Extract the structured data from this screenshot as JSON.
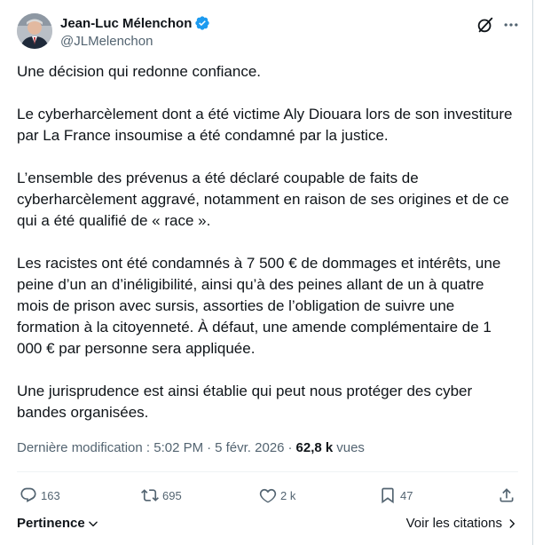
{
  "author": {
    "name": "Jean-Luc Mélenchon",
    "handle": "@JLMelenchon"
  },
  "tweet": {
    "paragraphs": [
      "Une décision qui redonne confiance.",
      "Le cyberharcèlement dont a été victime Aly Diouara lors de son investiture par La France insoumise a été condamné par la justice.",
      "L’ensemble des prévenus a été déclaré coupable de faits de cyberharcèlement aggravé, notamment en raison de ses origines et de ce qui a été qualifié de « race ».",
      "Les racistes ont été condamnés à 7 500 € de dommages et intérêts, une peine d’un an d’inéligibilité, ainsi qu’à des peines allant de un à quatre mois de prison avec sursis, assorties de l’obligation de suivre une formation à la citoyenneté. À défaut, une amende complémentaire de 1 000 € par personne sera appliquée.",
      "Une jurisprudence est ainsi établie qui peut nous protéger des cyber bandes organisées."
    ]
  },
  "meta": {
    "modified_label": "Dernière modification : 5:02 PM",
    "separator": "·",
    "date": "5 févr. 2026",
    "views_count": "62,8 k",
    "views_label": "vues"
  },
  "actions": {
    "replies": "163",
    "reposts": "695",
    "likes": "2 k",
    "bookmarks": "47"
  },
  "footer": {
    "sort_label": "Pertinence",
    "quotes_label": "Voir les citations"
  },
  "colors": {
    "text": "#0f1419",
    "muted": "#536471",
    "verified": "#1d9bf0",
    "divider": "#eff3f4"
  }
}
